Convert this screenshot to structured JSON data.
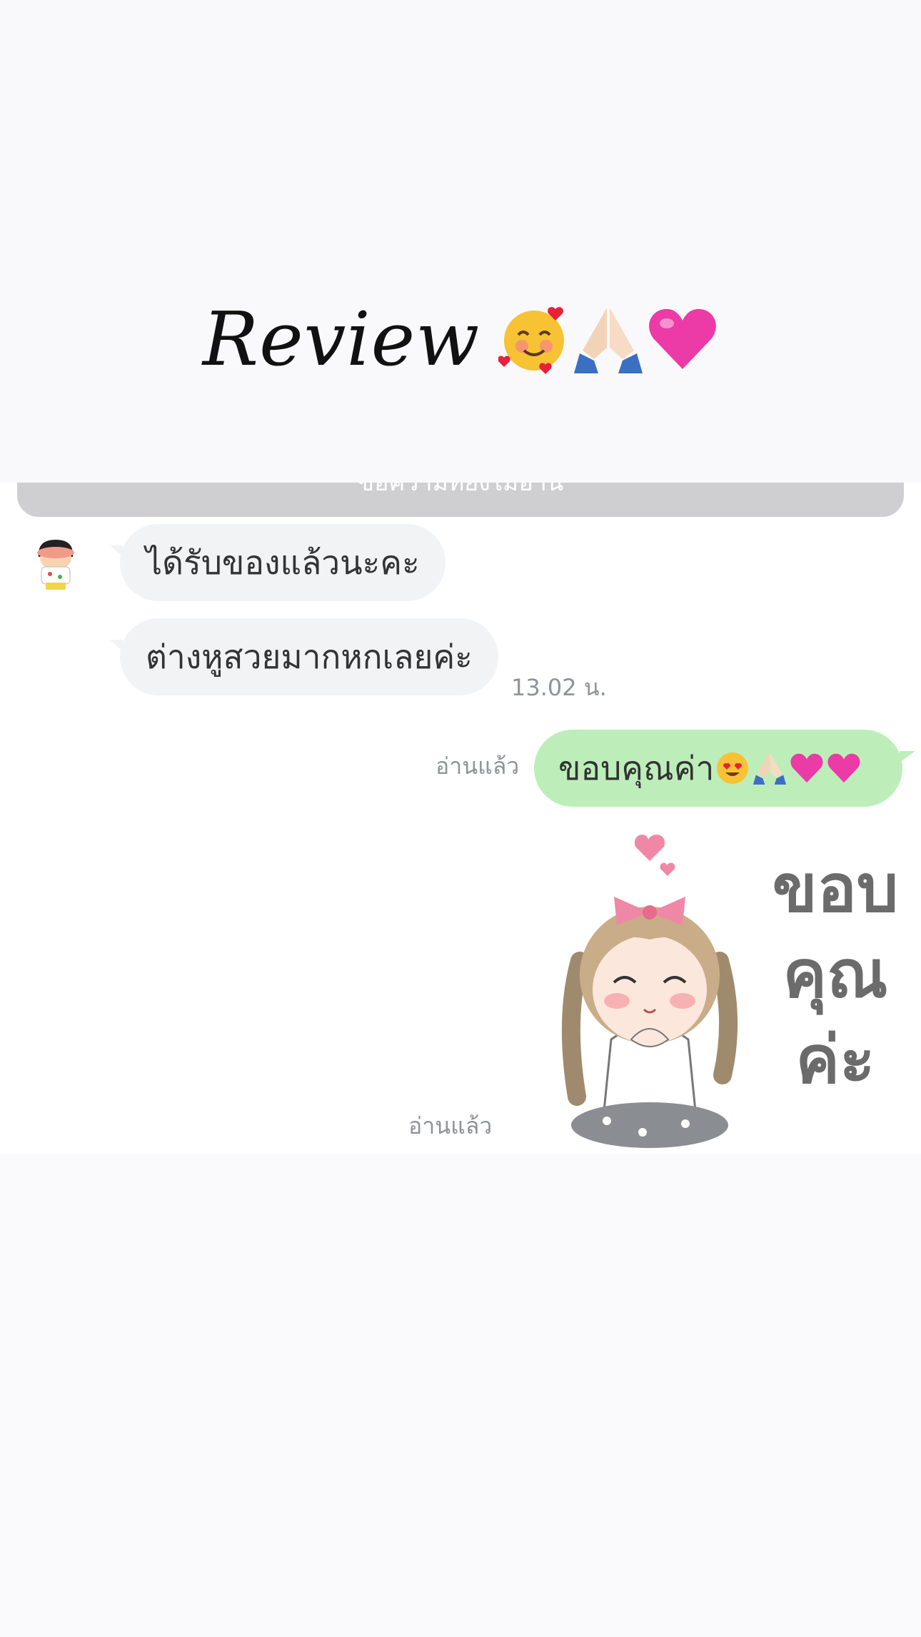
{
  "title": {
    "text": "Review",
    "emojis": [
      "smiling-face-with-hearts",
      "folded-hands",
      "pink-heart"
    ]
  },
  "notice": {
    "label": "ข้อความที่ยังไม่อ่าน"
  },
  "messages": {
    "incoming": [
      {
        "text": "ได้รับของแล้วนะคะ"
      },
      {
        "text": "ต่างหูสวยมากหกเลยค่ะ",
        "time": "13.02 น."
      }
    ],
    "outgoing": {
      "text": "ขอบคุณค่า",
      "emojis": [
        "heart-eyes",
        "folded-hands",
        "pink-heart",
        "pink-heart"
      ],
      "read_label": "อ่านแล้ว"
    },
    "sticker": {
      "text": "ขอบ คุณ ค่ะ",
      "read_label": "อ่านแล้ว"
    }
  },
  "colors": {
    "incoming_bubble": "#f2f3f5",
    "outgoing_bubble": "#bdeeba",
    "meta_text": "#8f9298",
    "sticker_heart": "#ef88a6"
  }
}
